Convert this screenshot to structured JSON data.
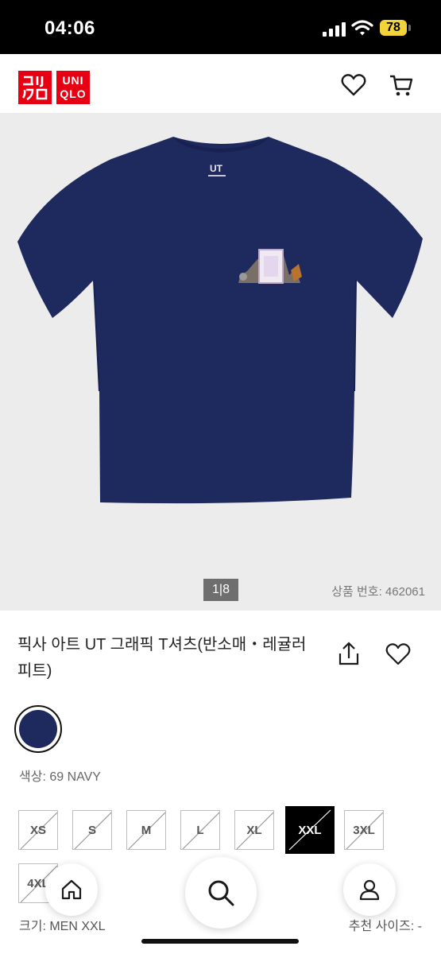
{
  "status_bar": {
    "time": "04:06",
    "battery": "78"
  },
  "header": {
    "logo_top": "ユニ クロ",
    "logo_uniqlo_1": "UNI",
    "logo_uniqlo_2": "QLO"
  },
  "gallery": {
    "pager": "1|8",
    "product_number": "상품 번호: 462061"
  },
  "product": {
    "title": "픽사 아트 UT 그래픽 T셔츠(반소매・레귤러 피트)",
    "color_label": "색상: 69 NAVY",
    "swatch_color": "#1e2a5e"
  },
  "sizes": [
    {
      "label": "XS",
      "available": false,
      "selected": false
    },
    {
      "label": "S",
      "available": false,
      "selected": false
    },
    {
      "label": "M",
      "available": false,
      "selected": false
    },
    {
      "label": "L",
      "available": false,
      "selected": false
    },
    {
      "label": "XL",
      "available": false,
      "selected": false
    },
    {
      "label": "XXL",
      "available": false,
      "selected": true
    },
    {
      "label": "3XL",
      "available": false,
      "selected": false
    },
    {
      "label": "4XL",
      "available": false,
      "selected": false
    }
  ],
  "size_label": "크기: MEN XXL",
  "recommend_label": "추천 사이즈: -",
  "icons": {
    "wishlist_header": "heart-icon",
    "cart": "cart-icon",
    "share": "share-icon",
    "wishlist_product": "heart-icon",
    "home": "home-icon",
    "search": "search-icon",
    "account": "user-icon"
  },
  "colors": {
    "brand": "#e60012",
    "battery": "#f2d338",
    "shirt": "#1e2a5e"
  }
}
